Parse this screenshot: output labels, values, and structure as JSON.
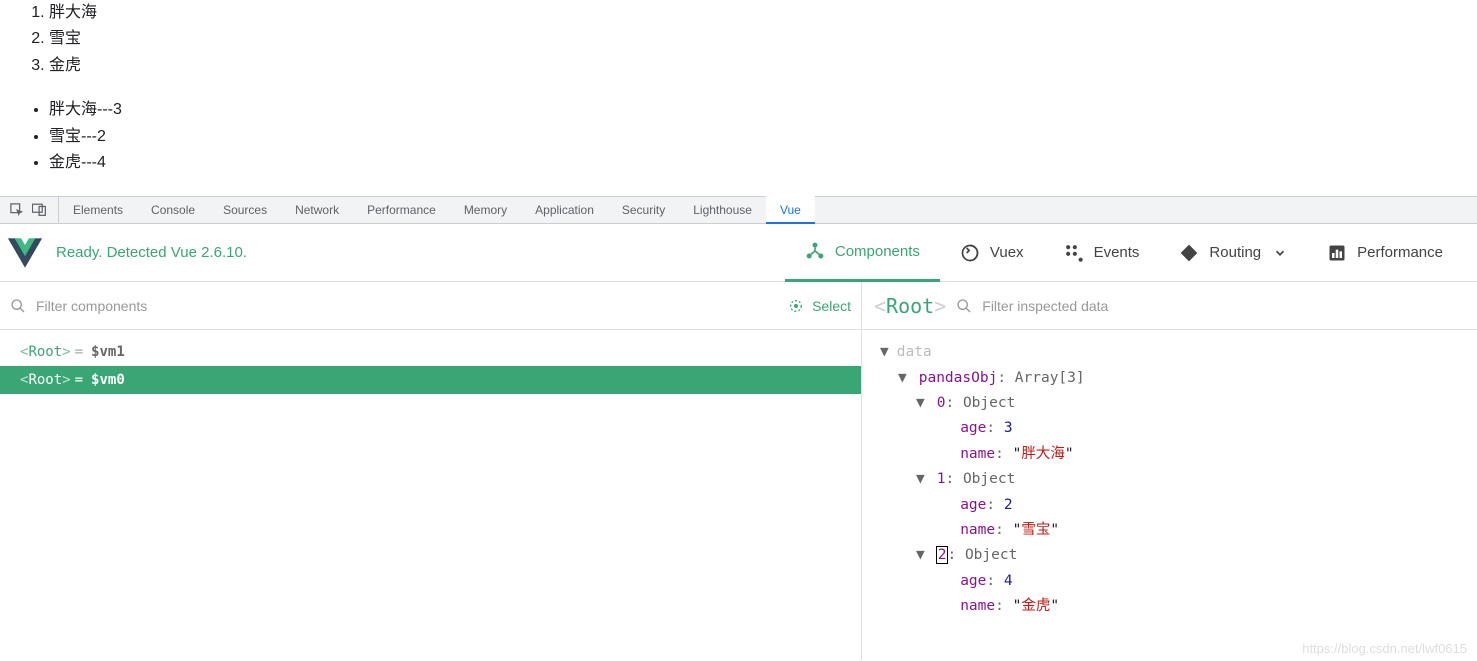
{
  "page": {
    "orderedItems": [
      "胖大海",
      "雪宝",
      "金虎"
    ],
    "bulletItems": [
      "胖大海---3",
      "雪宝---2",
      "金虎---4"
    ]
  },
  "devtoolsTabs": {
    "items": [
      "Elements",
      "Console",
      "Sources",
      "Network",
      "Performance",
      "Memory",
      "Application",
      "Security",
      "Lighthouse",
      "Vue"
    ],
    "active": "Vue"
  },
  "vuePanel": {
    "status": "Ready. Detected Vue 2.6.10.",
    "tabs": {
      "components": "Components",
      "vuex": "Vuex",
      "events": "Events",
      "routing": "Routing",
      "performance": "Performance"
    },
    "filterComponentsPlaceholder": "Filter components",
    "selectLabel": "Select",
    "tree": [
      {
        "label": "Root",
        "vm": "$vm1",
        "selected": false
      },
      {
        "label": "Root",
        "vm": "$vm0",
        "selected": true
      }
    ]
  },
  "inspector": {
    "title": "Root",
    "filterPlaceholder": "Filter inspected data",
    "sectionLabel": "data",
    "objKey": "pandasObj",
    "objType": "Array[3]",
    "entries": [
      {
        "idx": "0",
        "type": "Object",
        "age": "3",
        "name": "胖大海",
        "boxed": false
      },
      {
        "idx": "1",
        "type": "Object",
        "age": "2",
        "name": "雪宝",
        "boxed": false
      },
      {
        "idx": "2",
        "type": "Object",
        "age": "4",
        "name": "金虎",
        "boxed": true
      }
    ],
    "labels": {
      "age": "age",
      "name": "name"
    }
  },
  "watermark": "https://blog.csdn.net/lwf0615"
}
